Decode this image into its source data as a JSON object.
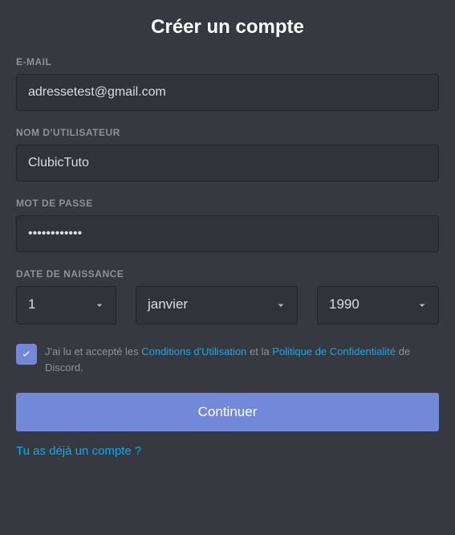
{
  "title": "Créer un compte",
  "email": {
    "label": "E-MAIL",
    "value": "adressetest@gmail.com"
  },
  "username": {
    "label": "NOM D'UTILISATEUR",
    "value": "ClubicTuto"
  },
  "password": {
    "label": "MOT DE PASSE",
    "value": "••••••••••••"
  },
  "dob": {
    "label": "DATE DE NAISSANCE",
    "day": "1",
    "month": "janvier",
    "year": "1990"
  },
  "tos": {
    "prefix": "J'ai lu et accepté les ",
    "terms_link": "Conditions d'Utilisation",
    "mid": " et la ",
    "privacy_link": "Politique de Confidentialité",
    "suffix": " de Discord.",
    "checked": true
  },
  "submit_label": "Continuer",
  "already_account": "Tu as déjà un compte ?"
}
